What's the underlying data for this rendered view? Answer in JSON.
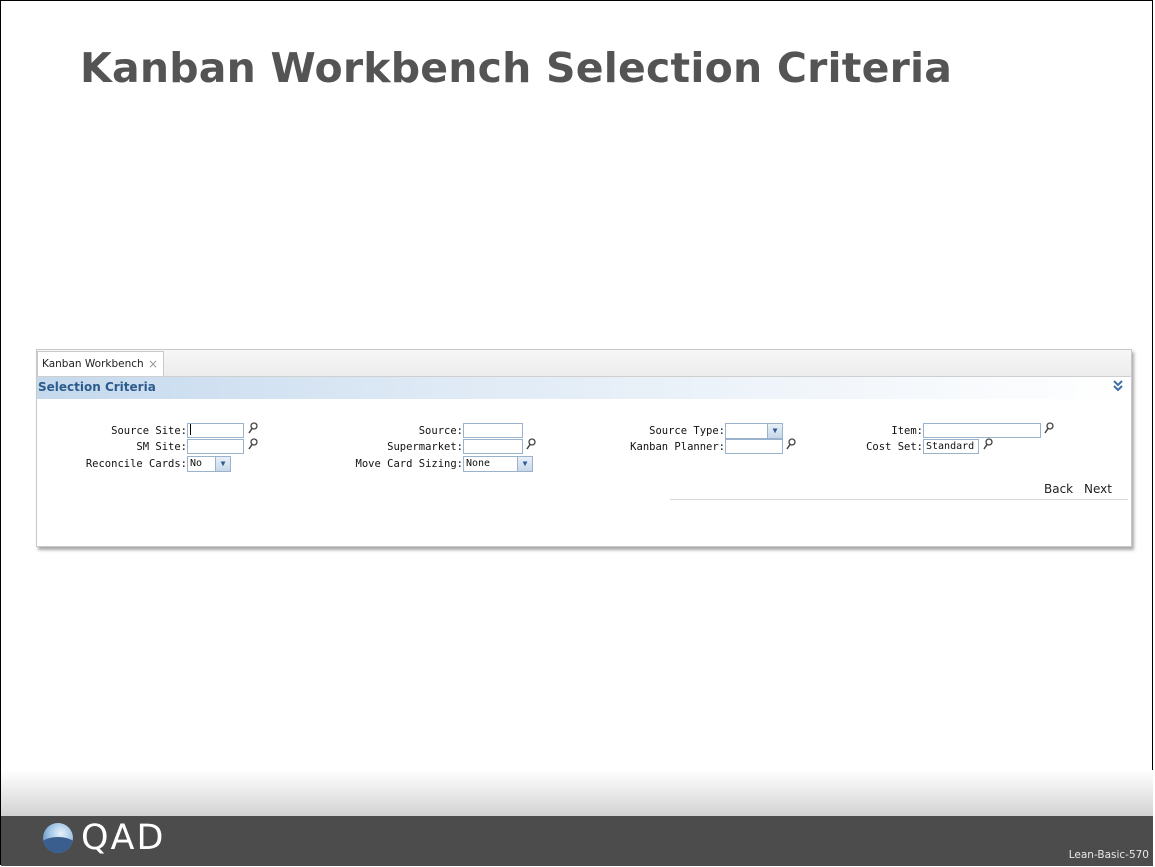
{
  "slide": {
    "title": "Kanban Workbench Selection Criteria",
    "code": "Lean-Basic-570"
  },
  "tab": {
    "label": "Kanban Workbench",
    "close_glyph": "×"
  },
  "section": {
    "title": "Selection Criteria",
    "collapse_glyph": "≽"
  },
  "form": {
    "source_site": {
      "label": "Source Site:",
      "value": ""
    },
    "sm_site": {
      "label": "SM Site:",
      "value": ""
    },
    "reconcile_cards": {
      "label": "Reconcile Cards:",
      "value": "No"
    },
    "source": {
      "label": "Source:",
      "value": ""
    },
    "supermarket": {
      "label": "Supermarket:",
      "value": ""
    },
    "move_card_sizing": {
      "label": "Move Card Sizing:",
      "value": "None"
    },
    "source_type": {
      "label": "Source Type:",
      "value": ""
    },
    "kanban_planner": {
      "label": "Kanban Planner:",
      "value": ""
    },
    "item": {
      "label": "Item:",
      "value": ""
    },
    "cost_set": {
      "label": "Cost Set:",
      "value": "Standard"
    }
  },
  "nav": {
    "back_label": "Back",
    "next_label": "Next"
  },
  "footer": {
    "brand": "QAD"
  },
  "colors": {
    "title_text": "#545454",
    "section_title": "#2d5b8c",
    "footer_bar": "#4c4c4c",
    "field_border": "#9bb2cc"
  }
}
